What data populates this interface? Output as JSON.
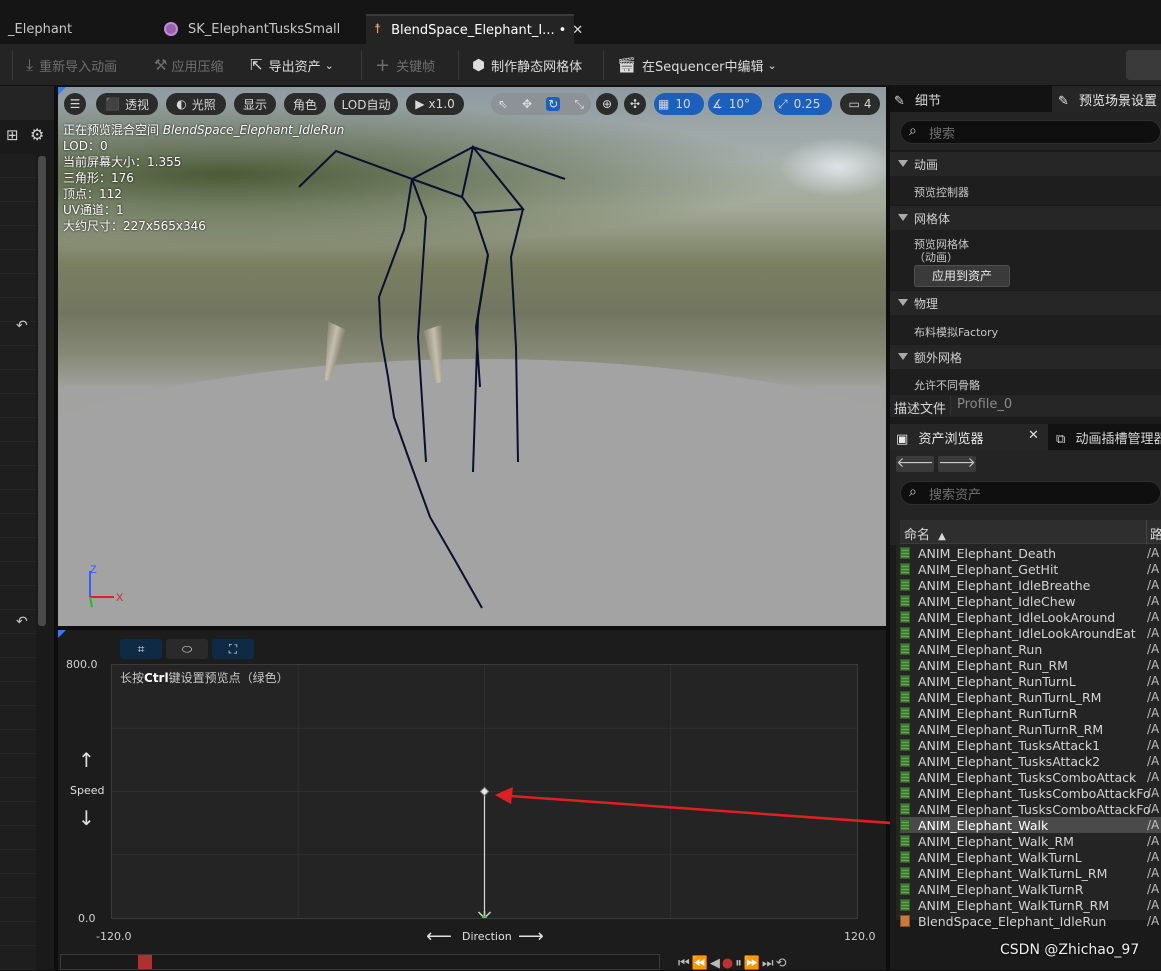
{
  "tabs": [
    {
      "label": "_Elephant"
    },
    {
      "label": "SK_ElephantTusksSmall"
    },
    {
      "label": "BlendSpace_Elephant_I...",
      "dirty": "•"
    }
  ],
  "toolbar": {
    "reimport": "重新导入动画",
    "apply_compression": "应用压缩",
    "export_asset": "导出资产",
    "keyframe": "关键帧",
    "make_static_mesh": "制作静态网格体",
    "edit_in_sequencer": "在Sequencer中编辑"
  },
  "viewport": {
    "buttons": {
      "perspective": "透视",
      "lighting": "光照",
      "show": "显示",
      "character": "角色",
      "lod": "LOD自动",
      "speed": "x1.0",
      "grid_snap": "10",
      "angle_snap": "10°",
      "scale_snap": "0.25",
      "camera_speed": "4"
    },
    "stats": {
      "preview_prefix": "正在预览混合空间 ",
      "preview_name": "BlendSpace_Elephant_IdleRun",
      "lod": "LOD：0",
      "screen_size": "当前屏幕大小：1.355",
      "triangles": "三角形：176",
      "vertices": "顶点：112",
      "uv_channels": "UV通道：1",
      "approx_size": "大约尺寸：227x565x346"
    },
    "axis": {
      "z": "Z",
      "x": "X"
    },
    "colors": {
      "axis_x": "#e02020",
      "axis_y": "#20c020",
      "axis_z": "#3060ff",
      "skeleton": "#0a0f2e"
    }
  },
  "blendspace": {
    "hint_prefix": "长按",
    "hint_bold": "Ctrl",
    "hint_suffix": "键设置预览点（绿色）",
    "y_axis_name": "Speed",
    "x_axis_name": "Direction",
    "y_max": "800.0",
    "y_min": "0.0",
    "x_min": "-120.0",
    "x_max": "120.0",
    "sample_point": {
      "direction": 0,
      "speed": 400
    },
    "preview_point": {
      "direction": 0,
      "speed": 0
    },
    "annotation_color": "#e02020"
  },
  "details": {
    "tab_details": "细节",
    "tab_preview_settings": "预览场景设置",
    "search_placeholder": "搜索",
    "sections": {
      "animation": "动画",
      "preview_controller": "预览控制器",
      "mesh": "网格体",
      "preview_mesh": "预览网格体",
      "preview_mesh_sub": "（动画）",
      "apply_to_asset": "应用到资产",
      "physics": "物理",
      "cloth_factory": "布料模拟Factory",
      "extra_mesh": "额外网格",
      "allow_diff_skeleton": "允许不同骨骼"
    },
    "profile_label": "描述文件",
    "profile_value": "Profile_0"
  },
  "asset_browser": {
    "tab_label": "资产浏览器",
    "tab_anim_slot": "动画插槽管理器",
    "search_placeholder": "搜索资产",
    "col_name": "命名",
    "col_path": "路",
    "items": [
      {
        "name": "ANIM_Elephant_Death",
        "path": "/A"
      },
      {
        "name": "ANIM_Elephant_GetHit",
        "path": "/A"
      },
      {
        "name": "ANIM_Elephant_IdleBreathe",
        "path": "/A"
      },
      {
        "name": "ANIM_Elephant_IdleChew",
        "path": "/A"
      },
      {
        "name": "ANIM_Elephant_IdleLookAround",
        "path": "/A"
      },
      {
        "name": "ANIM_Elephant_IdleLookAroundEat",
        "path": "/A"
      },
      {
        "name": "ANIM_Elephant_Run",
        "path": "/A"
      },
      {
        "name": "ANIM_Elephant_Run_RM",
        "path": "/A"
      },
      {
        "name": "ANIM_Elephant_RunTurnL",
        "path": "/A"
      },
      {
        "name": "ANIM_Elephant_RunTurnL_RM",
        "path": "/A"
      },
      {
        "name": "ANIM_Elephant_RunTurnR",
        "path": "/A"
      },
      {
        "name": "ANIM_Elephant_RunTurnR_RM",
        "path": "/A"
      },
      {
        "name": "ANIM_Elephant_TusksAttack1",
        "path": "/A"
      },
      {
        "name": "ANIM_Elephant_TusksAttack2",
        "path": "/A"
      },
      {
        "name": "ANIM_Elephant_TusksComboAttack",
        "path": "/A"
      },
      {
        "name": "ANIM_Elephant_TusksComboAttackFo",
        "path": "/A"
      },
      {
        "name": "ANIM_Elephant_TusksComboAttackFo",
        "path": "/A"
      },
      {
        "name": "ANIM_Elephant_Walk",
        "path": "/A",
        "selected": true
      },
      {
        "name": "ANIM_Elephant_Walk_RM",
        "path": "/A"
      },
      {
        "name": "ANIM_Elephant_WalkTurnL",
        "path": "/A"
      },
      {
        "name": "ANIM_Elephant_WalkTurnL_RM",
        "path": "/A"
      },
      {
        "name": "ANIM_Elephant_WalkTurnR",
        "path": "/A"
      },
      {
        "name": "ANIM_Elephant_WalkTurnR_RM",
        "path": "/A"
      },
      {
        "name": "BlendSpace_Elephant_IdleRun",
        "path": "/A",
        "kind": "blendspace"
      }
    ]
  },
  "watermark": "CSDN @Zhichao_97"
}
